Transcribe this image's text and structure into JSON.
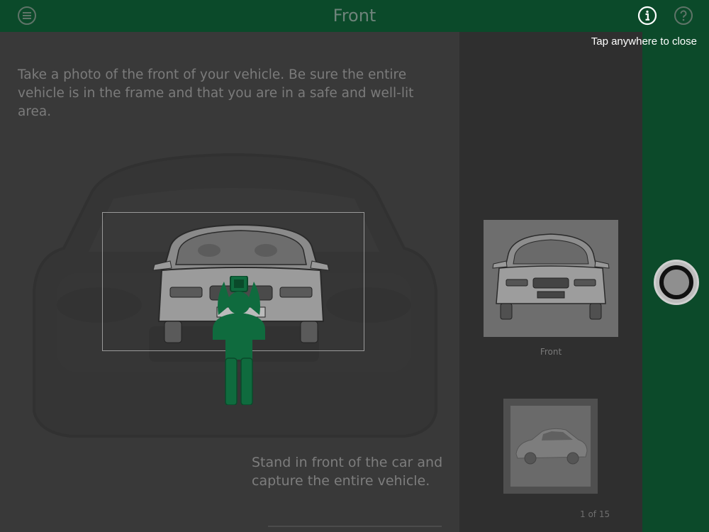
{
  "header": {
    "title": "Front",
    "menu_icon": "hamburger-menu-icon",
    "info_icon": "info-icon",
    "help_icon": "help-question-icon"
  },
  "overlay": {
    "close_hint": "Tap anywhere to close"
  },
  "main": {
    "instructions": "Take a photo of the front of your vehicle. Be sure the entire vehicle is in the frame and that you are in a safe and well-lit area.",
    "stand_hint": "Stand in front of the car and capture the entire vehicle."
  },
  "panel": {
    "thumbnails": [
      {
        "label": "Front",
        "icon": "car-front-thumbnail"
      },
      {
        "label": "",
        "icon": "car-side-thumbnail"
      }
    ],
    "pager": "1 of 15"
  },
  "colors": {
    "brand_green": "#0b4a2a",
    "accent_green": "#0f6b3e",
    "dim_overlay": "#393939"
  }
}
